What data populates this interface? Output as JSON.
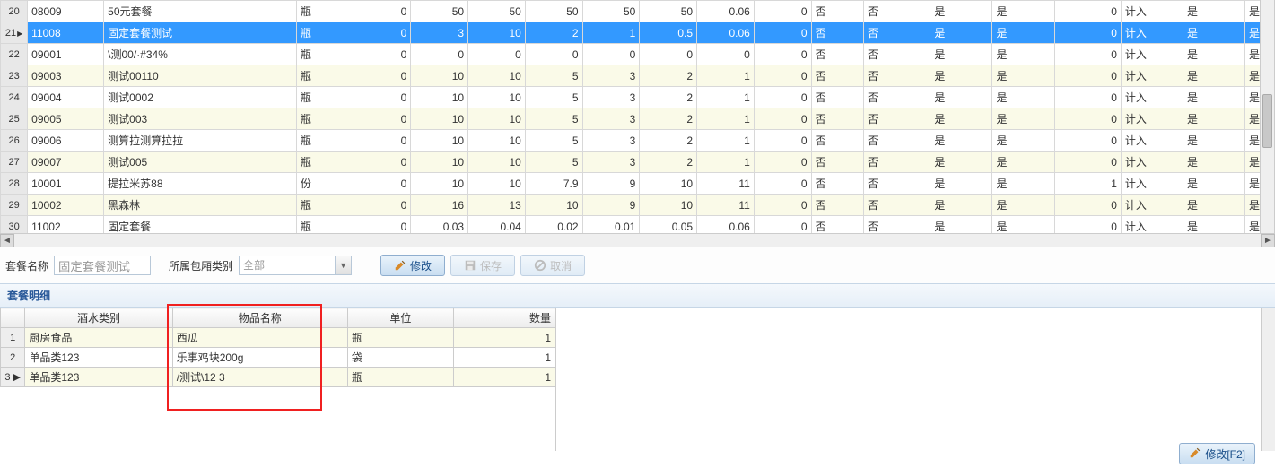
{
  "main_rows": [
    {
      "n": 20,
      "code": "08009",
      "name": "50元套餐",
      "unit": "瓶",
      "v": [
        0,
        50,
        50,
        50,
        50,
        50,
        0.06,
        0
      ],
      "f": [
        "否",
        "否",
        "是",
        "是"
      ],
      "v9": 0,
      "f5": "计入",
      "f6": "是",
      "f7": "是"
    },
    {
      "n": 21,
      "code": "11008",
      "name": "固定套餐测试",
      "unit": "瓶",
      "v": [
        0,
        3,
        10,
        2,
        1,
        0.5,
        0.06,
        0
      ],
      "f": [
        "否",
        "否",
        "是",
        "是"
      ],
      "v9": 0,
      "f5": "计入",
      "f6": "是",
      "f7": "是",
      "selected": true
    },
    {
      "n": 22,
      "code": "09001",
      "name": "\\测00/·#34%",
      "unit": "瓶",
      "v": [
        0,
        0,
        0,
        0,
        0,
        0,
        0,
        0
      ],
      "f": [
        "否",
        "否",
        "是",
        "是"
      ],
      "v9": 0,
      "f5": "计入",
      "f6": "是",
      "f7": "是"
    },
    {
      "n": 23,
      "code": "09003",
      "name": " 测试00110",
      "unit": "瓶",
      "v": [
        0,
        10,
        10,
        5,
        3,
        2,
        1,
        0
      ],
      "f": [
        "否",
        "否",
        "是",
        "是"
      ],
      "v9": 0,
      "f5": "计入",
      "f6": "是",
      "f7": "是"
    },
    {
      "n": 24,
      "code": "09004",
      "name": "测试0002",
      "unit": "瓶",
      "v": [
        0,
        10,
        10,
        5,
        3,
        2,
        1,
        0
      ],
      "f": [
        "否",
        "否",
        "是",
        "是"
      ],
      "v9": 0,
      "f5": "计入",
      "f6": "是",
      "f7": "是"
    },
    {
      "n": 25,
      "code": "09005",
      "name": "测试003",
      "unit": "瓶",
      "v": [
        0,
        10,
        10,
        5,
        3,
        2,
        1,
        0
      ],
      "f": [
        "否",
        "否",
        "是",
        "是"
      ],
      "v9": 0,
      "f5": "计入",
      "f6": "是",
      "f7": "是"
    },
    {
      "n": 26,
      "code": "09006",
      "name": "测算拉测算拉拉",
      "unit": "瓶",
      "v": [
        0,
        10,
        10,
        5,
        3,
        2,
        1,
        0
      ],
      "f": [
        "否",
        "否",
        "是",
        "是"
      ],
      "v9": 0,
      "f5": "计入",
      "f6": "是",
      "f7": "是"
    },
    {
      "n": 27,
      "code": "09007",
      "name": "测试005",
      "unit": "瓶",
      "v": [
        0,
        10,
        10,
        5,
        3,
        2,
        1,
        0
      ],
      "f": [
        "否",
        "否",
        "是",
        "是"
      ],
      "v9": 0,
      "f5": "计入",
      "f6": "是",
      "f7": "是"
    },
    {
      "n": 28,
      "code": "10001",
      "name": "提拉米苏88",
      "unit": "份",
      "v": [
        0,
        10,
        10,
        7.9,
        9,
        10,
        11,
        0
      ],
      "f": [
        "否",
        "否",
        "是",
        "是"
      ],
      "v9": 1,
      "f5": "计入",
      "f6": "是",
      "f7": "是"
    },
    {
      "n": 29,
      "code": "10002",
      "name": "黑森林",
      "unit": "瓶",
      "v": [
        0,
        16,
        13,
        10,
        9,
        10,
        11,
        0
      ],
      "f": [
        "否",
        "否",
        "是",
        "是"
      ],
      "v9": 0,
      "f5": "计入",
      "f6": "是",
      "f7": "是"
    },
    {
      "n": 30,
      "code": "11002",
      "name": "固定套餐",
      "unit": "瓶",
      "v": [
        0,
        0.03,
        0.04,
        0.02,
        0.01,
        0.05,
        0.06,
        0
      ],
      "f": [
        "否",
        "否",
        "是",
        "是"
      ],
      "v9": 0,
      "f5": "计入",
      "f6": "是",
      "f7": "是"
    }
  ],
  "form": {
    "name_label": "套餐名称",
    "name_value": "固定套餐测试",
    "room_label": "所属包厢类别",
    "room_value": "全部",
    "btn_modify": "修改",
    "btn_save": "保存",
    "btn_cancel": "取消"
  },
  "detail": {
    "title": "套餐明细",
    "headers": {
      "cat": "酒水类别",
      "item": "物品名称",
      "unit": "单位",
      "qty": "数量"
    },
    "rows": [
      {
        "n": 1,
        "cat": "厨房食品",
        "item": "西瓜",
        "unit": "瓶",
        "qty": 1
      },
      {
        "n": 2,
        "cat": "单品类123",
        "item": "乐事鸡块200g",
        "unit": "袋",
        "qty": 1
      },
      {
        "n": 3,
        "cat": "单品类123",
        "item": "/测试\\12 3",
        "unit": "瓶",
        "qty": 1,
        "cursor": true
      }
    ]
  },
  "f2_btn": "修改[F2]"
}
